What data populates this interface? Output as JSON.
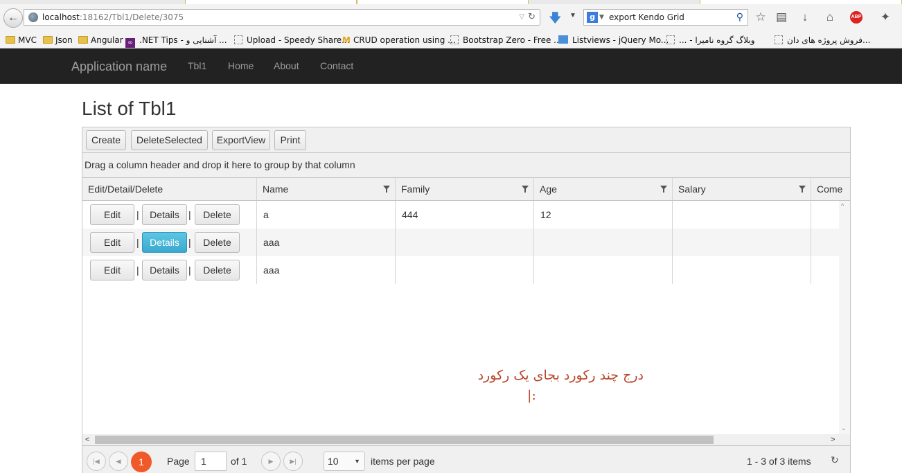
{
  "browser": {
    "url_host": "localhost",
    "url_path": ":18162/Tbl1/Delete/3075",
    "search_text": "export Kendo Grid",
    "abp_label": "ABP",
    "bookmarks": [
      {
        "label": "MVC",
        "icon": "folder"
      },
      {
        "label": "Json",
        "icon": "folder"
      },
      {
        "label": "Angular",
        "icon": "folder"
      },
      {
        "label": ".NET Tips - آشنایی و ...",
        "icon": "vs"
      },
      {
        "label": "Upload - Speedy Share...",
        "icon": "page"
      },
      {
        "label": "CRUD operation using ...",
        "icon": "m"
      },
      {
        "label": "Bootstrap Zero - Free ...",
        "icon": "page"
      },
      {
        "label": "Listviews - jQuery Mo...",
        "icon": "lv"
      },
      {
        "label": "... - وبلاگ گروه نامیرا",
        "icon": "page"
      },
      {
        "label": "فروش پروژه های دان...",
        "icon": "page"
      }
    ]
  },
  "navbar": {
    "brand": "Application name",
    "links": [
      "Tbl1",
      "Home",
      "About",
      "Contact"
    ]
  },
  "page": {
    "title": "List of Tbl1"
  },
  "grid": {
    "toolbar": [
      "Create",
      "DeleteSelected",
      "ExportView",
      "Print"
    ],
    "group_hint": "Drag a column header and drop it here to group by that column",
    "columns": [
      "Edit/Detail/Delete",
      "Name",
      "Family",
      "Age",
      "Salary",
      "Come"
    ],
    "row_buttons": {
      "edit": "Edit",
      "details": "Details",
      "delete": "Delete",
      "separator": "|"
    },
    "rows": [
      {
        "name": "a",
        "family": "444",
        "age": "12",
        "salary": ""
      },
      {
        "name": "aaa",
        "family": "",
        "age": "",
        "salary": ""
      },
      {
        "name": "aaa",
        "family": "",
        "age": "",
        "salary": ""
      }
    ],
    "annotation_line1": "درج چند رکورد بجای یک رکورد",
    "annotation_line2": "|:",
    "pager": {
      "current_page": "1",
      "page_label": "Page",
      "page_input": "1",
      "of_label": "of 1",
      "page_size": "10",
      "per_page_label": "items per page",
      "summary": "1 - 3 of 3 items"
    }
  },
  "colors": {
    "navbar_bg": "#222222",
    "active_button": "#3aa9cf",
    "current_page": "#f05a28",
    "annotation": "#b9452a"
  }
}
